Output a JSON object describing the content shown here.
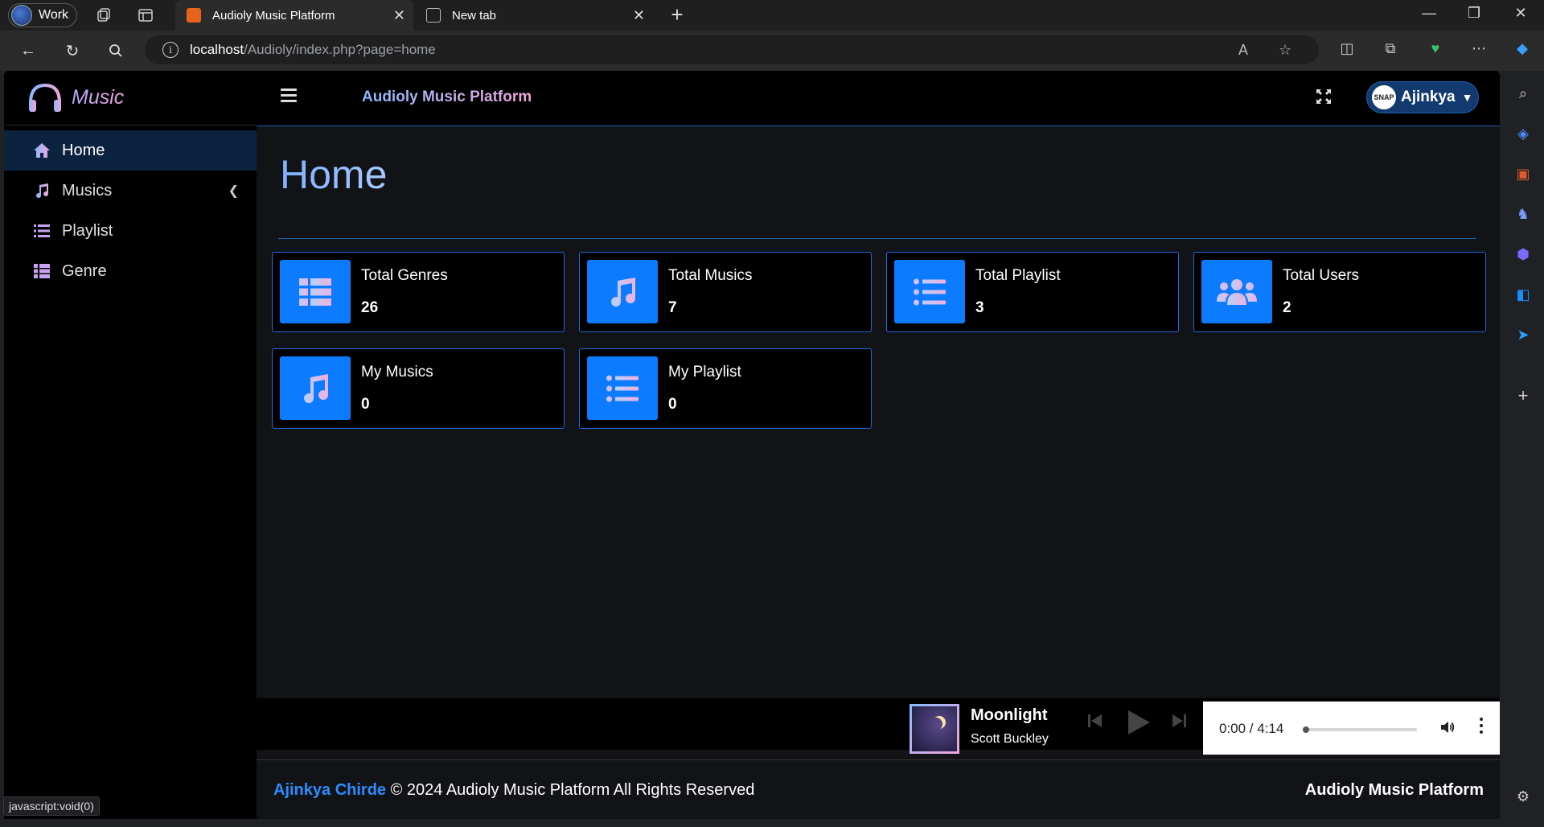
{
  "browser": {
    "profile_label": "Work",
    "tabs": [
      {
        "title": "Audioly Music Platform",
        "active": true
      },
      {
        "title": "New tab",
        "active": false
      }
    ],
    "url_host": "localhost",
    "url_path": "/Audioly/index.php?page=home",
    "status_url": "javascript:void(0)"
  },
  "brand": {
    "text": "Music"
  },
  "sidebar": {
    "items": [
      {
        "label": "Home",
        "icon": "home-icon",
        "active": true
      },
      {
        "label": "Musics",
        "icon": "music-note-icon",
        "has_submenu": true
      },
      {
        "label": "Playlist",
        "icon": "list-icon"
      },
      {
        "label": "Genre",
        "icon": "table-list-icon"
      }
    ]
  },
  "topbar": {
    "title": "Audioly Music Platform",
    "user": {
      "name": "Ajinkya",
      "avatar_text": "SNAP"
    }
  },
  "main": {
    "page_title": "Home",
    "cards": [
      {
        "label": "Total Genres",
        "value": "26",
        "icon": "table-list-icon"
      },
      {
        "label": "Total Musics",
        "value": "7",
        "icon": "music-note-icon"
      },
      {
        "label": "Total Playlist",
        "value": "3",
        "icon": "list-icon"
      },
      {
        "label": "Total Users",
        "value": "2",
        "icon": "users-icon"
      },
      {
        "label": "My Musics",
        "value": "0",
        "icon": "music-note-icon"
      },
      {
        "label": "My Playlist",
        "value": "0",
        "icon": "list-icon"
      }
    ]
  },
  "player": {
    "title": "Moonlight",
    "artist": "Scott Buckley",
    "time": "0:00 / 4:14",
    "progress": 0
  },
  "footer": {
    "author": "Ajinkya Chirde",
    "copyright": " © 2024 Audioly Music Platform All Rights Reserved",
    "brand": "Audioly Music Platform"
  },
  "colors": {
    "accent": "#0d7bff",
    "border": "#1e6be0",
    "active_menu": "#0c2340"
  }
}
